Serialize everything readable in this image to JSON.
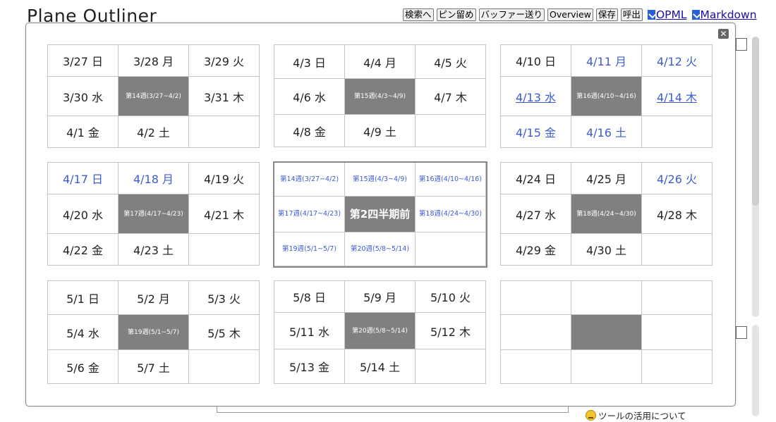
{
  "app": {
    "title": "Plane Outliner"
  },
  "toolbar": {
    "buttons": [
      "検索へ",
      "ピン留め",
      "バッファー送り",
      "Overview",
      "保存",
      "呼出"
    ],
    "links": [
      "OPML",
      "Markdown"
    ]
  },
  "footer": {
    "help_link": "ツールの活用について"
  },
  "colors": {
    "week_cell_bg": "#808080",
    "link_blue": "#3e5bd1",
    "border": "#c4c4c4"
  },
  "calendar": {
    "week_grids": [
      {
        "days": [
          "3/27 日",
          "3/28 月",
          "3/29 火",
          "3/30 水",
          "3/31 木",
          "4/1 金",
          "4/2 土"
        ],
        "week_label": "第14週(3/27~4/2)"
      },
      {
        "days": [
          "4/3 日",
          "4/4 月",
          "4/5 火",
          "4/6 水",
          "4/7 木",
          "4/8 金",
          "4/9 土"
        ],
        "week_label": "第15週(4/3~4/9)"
      },
      {
        "days": [
          "4/10 日",
          "4/11 月",
          "4/12 火",
          "4/13 水",
          "4/14 木",
          "4/15 金",
          "4/16 土"
        ],
        "week_label": "第16週(4/10~4/16)"
      },
      {
        "days": [
          "4/17 日",
          "4/18 月",
          "4/19 火",
          "4/20 水",
          "4/21 木",
          "4/22 金",
          "4/23 土"
        ],
        "week_label": "第17週(4/17~4/23)"
      },
      {
        "days": [
          "4/24 日",
          "4/25 月",
          "4/26 火",
          "4/27 水",
          "4/28 木",
          "4/29 金",
          "4/30 土"
        ],
        "week_label": "第18週(4/24~4/30)"
      },
      {
        "days": [
          "5/1 日",
          "5/2 月",
          "5/3 火",
          "5/4 水",
          "5/5 木",
          "5/6 金",
          "5/7 土"
        ],
        "week_label": "第19週(5/1~5/7)"
      },
      {
        "days": [
          "5/8 日",
          "5/9 月",
          "5/10 火",
          "5/11 水",
          "5/12 木",
          "5/13 金",
          "5/14 土"
        ],
        "week_label": "第20週(5/8~5/14)"
      }
    ],
    "quarter": {
      "title": "第2四半期前",
      "weeks": [
        "第14週(3/27~4/2)",
        "第15週(4/3~4/9)",
        "第16週(4/10~4/16)",
        "第17週(4/17~4/23)",
        "第18週(4/24~4/30)",
        "第19週(5/1~5/7)",
        "第20週(5/8~5/14)"
      ]
    }
  }
}
